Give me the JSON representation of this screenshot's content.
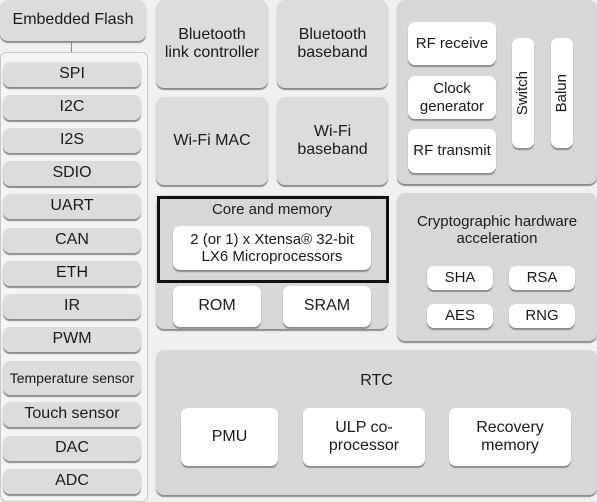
{
  "embedded_flash": "Embedded Flash",
  "peripherals": [
    "SPI",
    "I2C",
    "I2S",
    "SDIO",
    "UART",
    "CAN",
    "ETH",
    "IR",
    "PWM",
    "Temperature sensor",
    "Touch sensor",
    "DAC",
    "ADC"
  ],
  "bluetooth": {
    "link_controller": "Bluetooth link controller",
    "baseband": "Bluetooth baseband"
  },
  "wifi": {
    "mac": "Wi-Fi MAC",
    "baseband": "Wi-Fi baseband"
  },
  "rf": {
    "receive": "RF receive",
    "clock": "Clock generator",
    "transmit": "RF transmit",
    "switch": "Switch",
    "balun": "Balun"
  },
  "core": {
    "title": "Core and memory",
    "cpu": "2 (or 1) x Xtensa® 32-bit LX6 Microprocessors",
    "rom": "ROM",
    "sram": "SRAM"
  },
  "crypto": {
    "title": "Cryptographic hardware acceleration",
    "sha": "SHA",
    "rsa": "RSA",
    "aes": "AES",
    "rng": "RNG"
  },
  "rtc": {
    "title": "RTC",
    "pmu": "PMU",
    "ulp": "ULP co-processor",
    "recovery": "Recovery memory"
  }
}
